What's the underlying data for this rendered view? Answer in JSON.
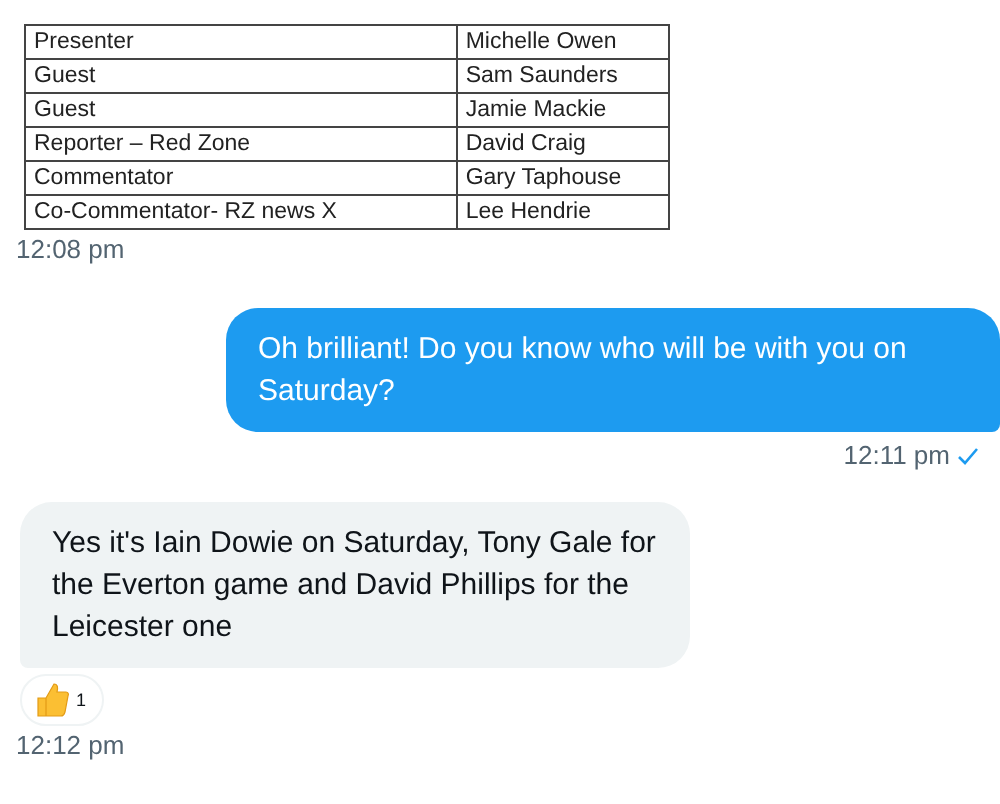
{
  "messages": [
    {
      "kind": "table",
      "rows": [
        {
          "role": "Presenter",
          "name": "Michelle Owen"
        },
        {
          "role": "Guest",
          "name": "Sam Saunders"
        },
        {
          "role": "Guest",
          "name": "Jamie Mackie"
        },
        {
          "role": "Reporter – Red Zone",
          "name": "David Craig"
        },
        {
          "role": "Commentator",
          "name": "Gary Taphouse"
        },
        {
          "role": "Co-Commentator- RZ news X",
          "name": "Lee Hendrie"
        }
      ],
      "time": "12:08 pm"
    },
    {
      "kind": "outgoing",
      "text": "Oh brilliant! Do you know who will be with you on Saturday?",
      "time": "12:11 pm",
      "read": true
    },
    {
      "kind": "incoming",
      "text": "Yes it's Iain Dowie on Saturday, Tony Gale for the Everton game and David Phillips for the Leicester one",
      "reaction": {
        "count": "1"
      },
      "time": "12:12 pm"
    }
  ]
}
